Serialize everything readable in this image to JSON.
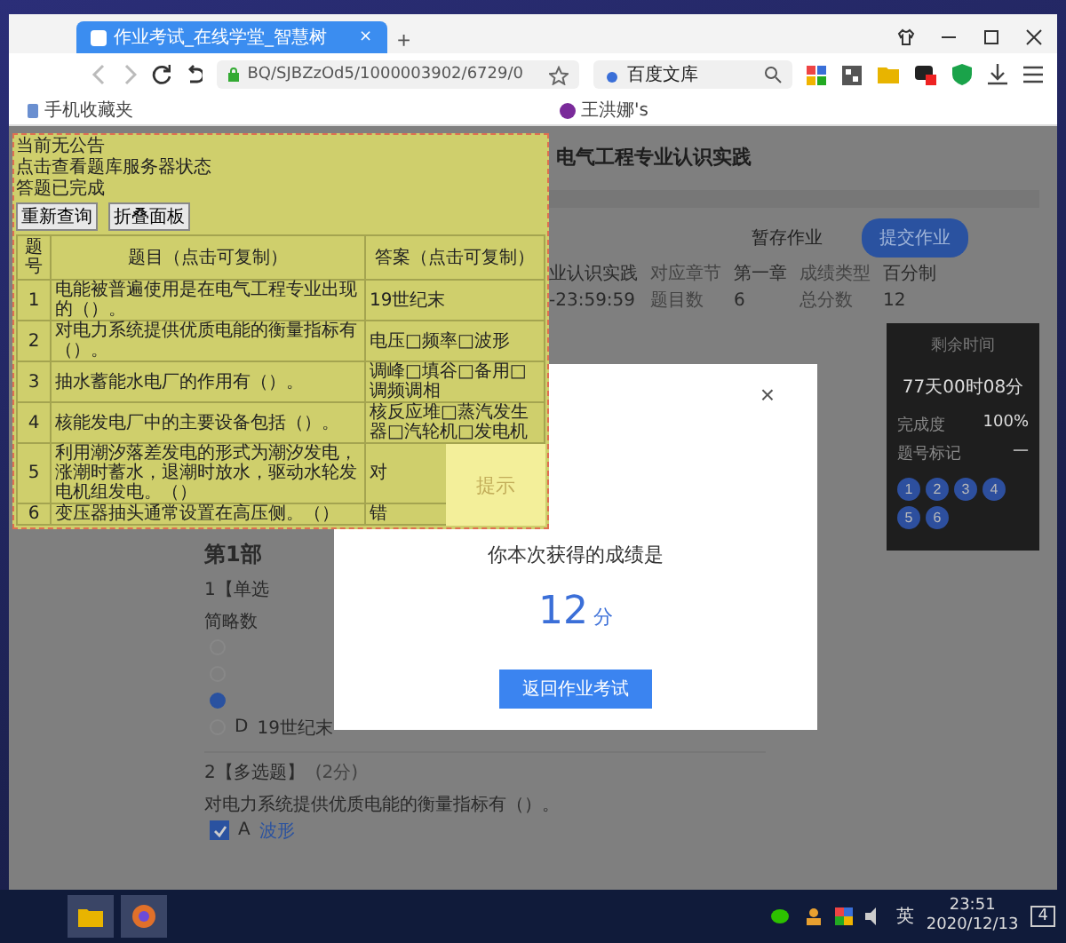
{
  "browser": {
    "tabs": [
      {
        "title": "作业考试_在线学堂_智慧树",
        "close": "×",
        "selected": true
      }
    ],
    "new_tab": "+",
    "address": "BQ/SJBZzOd5/1000003902/6729/0",
    "search": {
      "value": "百度文库"
    },
    "bookmarks": [
      "手机收藏夹",
      "王洪娜's"
    ]
  },
  "page": {
    "breadcrumb": "电气工程专业认识实践",
    "actions": [
      {
        "label": "暂存作业",
        "kind": "plain"
      },
      {
        "label": "提交作业",
        "kind": "primary"
      }
    ],
    "info_rows": [
      {
        "lead": "业认识实践",
        "fields": [
          {
            "label": "对应章节",
            "value": "第一章"
          },
          {
            "label": "成绩类型",
            "value": "百分制"
          }
        ]
      },
      {
        "lead": "-23:59:59",
        "fields": [
          {
            "label": "题目数",
            "value": "6"
          },
          {
            "label": "总分数",
            "value": "12"
          }
        ]
      }
    ]
  },
  "side_panel": {
    "title": "剩余时间",
    "countdown": "77天00时08分",
    "rows": [
      {
        "label": "完成度",
        "value": "100%"
      },
      {
        "label": "题号标记",
        "value": "—"
      }
    ],
    "numbers": [
      {
        "label": "1",
        "answered": true
      },
      {
        "label": "2",
        "answered": true
      },
      {
        "label": "3",
        "answered": true
      },
      {
        "label": "4",
        "answered": true
      },
      {
        "label": "5",
        "answered": true
      },
      {
        "label": "6",
        "answered": true
      }
    ]
  },
  "section_title": "第1部",
  "questions": [
    {
      "number": "1【单选",
      "text": "简略数",
      "options": [
        {
          "selected": false,
          "kind": "radio"
        },
        {
          "selected": false,
          "kind": "radio"
        },
        {
          "selected": true,
          "kind": "radio"
        },
        {
          "letter": "D",
          "text": "19世纪末",
          "selected": false,
          "kind": "radio"
        }
      ]
    },
    {
      "number": "2【多选题】",
      "points": "(2分)",
      "text": "对电力系统提供优质电能的衡量指标有（）。",
      "options": [
        {
          "letter": "A",
          "text": "波形",
          "selected": true,
          "kind": "checkbox"
        }
      ]
    }
  ],
  "modal": {
    "close": "×",
    "heading": "你本次获得的成绩是",
    "score": "12",
    "unit": "分",
    "button": "返回作业考试"
  },
  "helper_panel": {
    "lines": [
      "当前无公告",
      "点击查看题库服务器状态",
      "答题已完成"
    ],
    "buttons": [
      "重新查询",
      "折叠面板"
    ],
    "columns": [
      "题号",
      "题目（点击可复制）",
      "答案（点击可复制）"
    ],
    "rows": [
      {
        "number": "1",
        "question": "电能被普遍使用是在电气工程专业出现的（）。",
        "answer": "19世纪末"
      },
      {
        "number": "2",
        "question": "对电力系统提供优质电能的衡量指标有（）。",
        "answer": "电压□频率□波形"
      },
      {
        "number": "3",
        "question": "抽水蓄能水电厂的作用有（）。",
        "answer": "调峰□填谷□备用□调频调相"
      },
      {
        "number": "4",
        "question": "核能发电厂中的主要设备包括（）。",
        "answer": "核反应堆□蒸汽发生器□汽轮机□发电机"
      },
      {
        "number": "5",
        "question": "利用潮汐落差发电的形式为潮汐发电，涨潮时蓄水，退潮时放水，驱动水轮发电机组发电。（）",
        "answer": "对"
      },
      {
        "number": "6",
        "question": "变压器抽头通常设置在高压侧。（）",
        "answer": "错"
      }
    ],
    "hint": "提示"
  },
  "taskbar": {
    "ime": "英",
    "time": "23:51",
    "date": "2020/12/13",
    "notifications": "4"
  }
}
